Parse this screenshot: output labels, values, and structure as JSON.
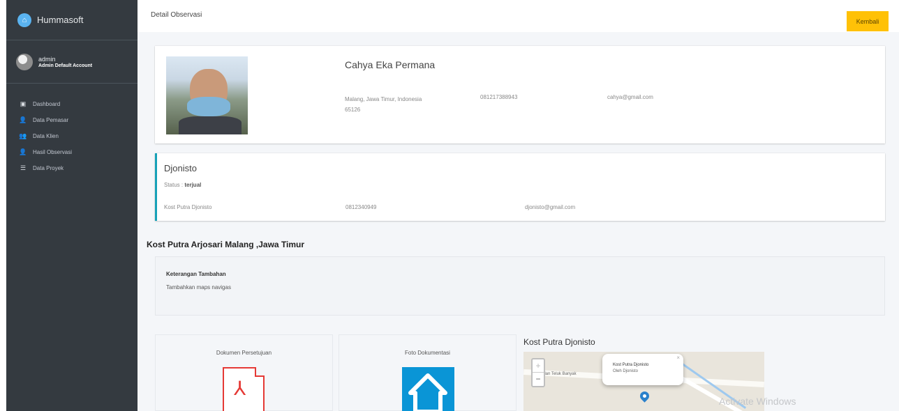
{
  "sidebar": {
    "brand": "Hummasoft",
    "user": {
      "name": "admin",
      "role": "Admin Default Account"
    },
    "items": [
      {
        "label": "Dashboard",
        "icon": "dashboard-icon"
      },
      {
        "label": "Data Pemasar",
        "icon": "user-icon"
      },
      {
        "label": "Data Klien",
        "icon": "users-icon"
      },
      {
        "label": "Hasil Observasi",
        "icon": "user-icon"
      },
      {
        "label": "Data Proyek",
        "icon": "list-icon"
      }
    ]
  },
  "header": {
    "title": "Detail Observasi",
    "back_label": "Kembali"
  },
  "observer": {
    "name": "Cahya Eka Permana",
    "address_line1": "Malang, Jawa Timur, Indonesia",
    "address_line2": "65126",
    "phone": "081217388943",
    "email": "cahya@gmail.com"
  },
  "client": {
    "name": "Djonisto",
    "status_label": "Status :",
    "status_value": "terjual",
    "kost": "Kost Putra Djonisto",
    "phone": "0812340949",
    "email": "djonisto@gmail.com"
  },
  "kost_title": "Kost Putra Arjosari Malang ,Jawa Timur",
  "info": {
    "label": "Keterangan Tambahan",
    "text": "Tambahkan maps navigas"
  },
  "documents": {
    "agreement_label": "Dokumen Persetujuan",
    "photo_label": "Foto Dokumentasi"
  },
  "map": {
    "title": "Kost Putra Djonisto",
    "zoom_in": "+",
    "zoom_out": "−",
    "road_label": "Jalan Teluk Banyak",
    "popup_title": "Kost Putra Djonisto",
    "popup_subtitle": "Oleh Djonisto",
    "popup_close": "×"
  },
  "watermark": "Activate Windows",
  "colors": {
    "sidebar": "#343a40",
    "accent_info": "#17a2b8",
    "button_warning": "#ffc107",
    "pdf_red": "#e53935",
    "photo_blue": "#0a95d6"
  }
}
